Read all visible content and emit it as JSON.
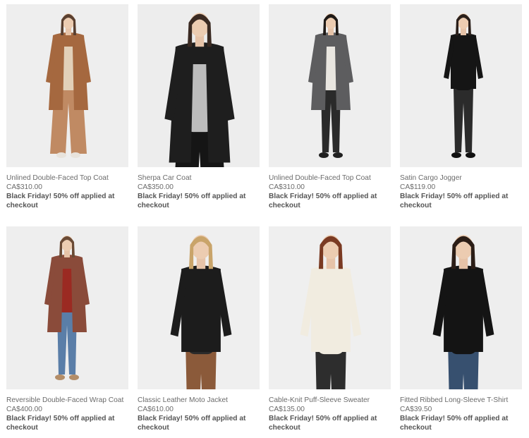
{
  "products": [
    {
      "name": "Unlined Double-Faced Top Coat",
      "price": "CA$310.00",
      "promo": "Black Friday! 50% off applied at checkout",
      "colors": {
        "bg": "#eeeeee",
        "top": "#a5683f",
        "bottom": "#c08a63",
        "inner": "#e2d0b8",
        "hair": "#5a4030",
        "shoe": "#e8e3dc"
      }
    },
    {
      "name": "Sherpa Car Coat",
      "price": "CA$350.00",
      "promo": "Black Friday! 50% off applied at checkout",
      "colors": {
        "bg": "#ededed",
        "top": "#1e1e1e",
        "bottom": "#151515",
        "inner": "#bcbcbc",
        "hair": "#3a2a22",
        "shoe": "#1a1a1a"
      }
    },
    {
      "name": "Unlined Double-Faced Top Coat",
      "price": "CA$310.00",
      "promo": "Black Friday! 50% off applied at checkout",
      "colors": {
        "bg": "#eeeeee",
        "top": "#5d5d5f",
        "bottom": "#2a2a2a",
        "inner": "#e9e6e0",
        "hair": "#1f1a17",
        "shoe": "#202020"
      }
    },
    {
      "name": "Satin Cargo Jogger",
      "price": "CA$119.00",
      "promo": "Black Friday! 50% off applied at checkout",
      "colors": {
        "bg": "#eeeeee",
        "top": "#151515",
        "bottom": "#2b2b2b",
        "inner": "#151515",
        "hair": "#2b201b",
        "shoe": "#111111"
      }
    },
    {
      "name": "Reversible Double-Faced Wrap Coat",
      "price": "CA$400.00",
      "promo": "Black Friday! 50% off applied at checkout",
      "colors": {
        "bg": "#eeeeee",
        "top": "#8a4b3a",
        "bottom": "#5a7ea8",
        "inner": "#9b2a22",
        "hair": "#6a4a35",
        "shoe": "#b38d68"
      }
    },
    {
      "name": "Classic Leather Moto Jacket",
      "price": "CA$610.00",
      "promo": "Black Friday! 50% off applied at checkout",
      "colors": {
        "bg": "#efefef",
        "top": "#1c1c1c",
        "bottom": "#8b5a3a",
        "inner": "#2a2a2a",
        "hair": "#c9a46a",
        "shoe": "#1c1c1c"
      }
    },
    {
      "name": "Cable-Knit Puff-Sleeve Sweater",
      "price": "CA$135.00",
      "promo": "Black Friday! 50% off applied at checkout",
      "colors": {
        "bg": "#efefef",
        "top": "#f1ece0",
        "bottom": "#2d2d2d",
        "inner": "#f1ece0",
        "hair": "#7a3a22",
        "shoe": "#2d2d2d"
      }
    },
    {
      "name": "Fitted Ribbed Long-Sleeve T-Shirt",
      "price": "CA$39.50",
      "promo": "Black Friday! 50% off applied at checkout",
      "colors": {
        "bg": "#eeeeee",
        "top": "#141414",
        "bottom": "#37506f",
        "inner": "#141414",
        "hair": "#2b1d16",
        "shoe": "#37506f"
      }
    }
  ]
}
